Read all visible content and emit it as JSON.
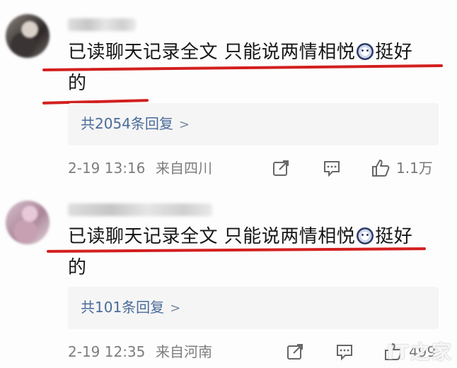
{
  "comments": [
    {
      "text_line1": "已读聊天记录全文 只能说两情相悦",
      "text_line1_after_emoji": "挺好",
      "text_line2": "的",
      "emoji": "wide-eyes-emoji",
      "replies_label": "共2054条回复",
      "time": "2-19 13:16",
      "location": "来自四川",
      "likes": "1.1万"
    },
    {
      "text_line1": "已读聊天记录全文 只能说两情相悦",
      "text_line1_after_emoji": "挺好",
      "text_line2": "的",
      "emoji": "wide-eyes-emoji",
      "replies_label": "共101条回复",
      "time": "2-19 12:35",
      "location": "来自河南",
      "likes": "499"
    }
  ],
  "icons": {
    "share": "share-icon",
    "comment": "comment-icon",
    "like": "thumbs-up-icon",
    "chevron": "chevron-right-icon"
  },
  "colors": {
    "annotation_red": "#d31f1f",
    "reply_link": "#4a6b9a",
    "meta_gray": "#7d7d7d",
    "reply_bg": "#f5f5f5"
  },
  "watermark": "IT之家"
}
